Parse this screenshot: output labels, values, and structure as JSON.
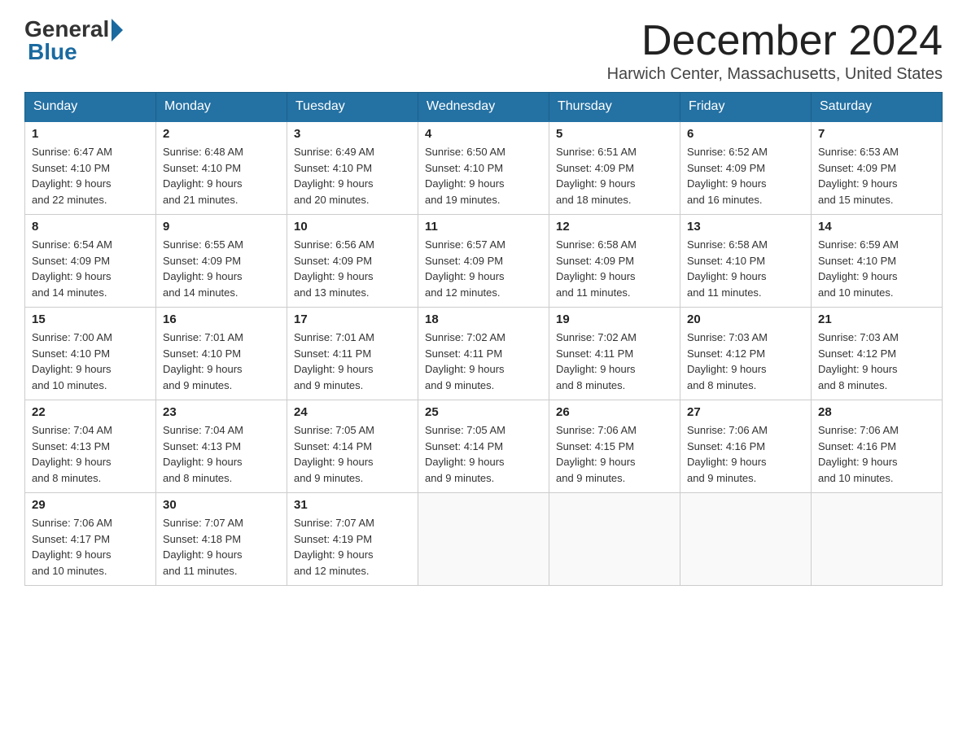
{
  "header": {
    "logo_general": "General",
    "logo_blue": "Blue",
    "month_title": "December 2024",
    "location": "Harwich Center, Massachusetts, United States"
  },
  "days_of_week": [
    "Sunday",
    "Monday",
    "Tuesday",
    "Wednesday",
    "Thursday",
    "Friday",
    "Saturday"
  ],
  "weeks": [
    [
      {
        "day": "1",
        "sunrise": "6:47 AM",
        "sunset": "4:10 PM",
        "daylight": "9 hours and 22 minutes."
      },
      {
        "day": "2",
        "sunrise": "6:48 AM",
        "sunset": "4:10 PM",
        "daylight": "9 hours and 21 minutes."
      },
      {
        "day": "3",
        "sunrise": "6:49 AM",
        "sunset": "4:10 PM",
        "daylight": "9 hours and 20 minutes."
      },
      {
        "day": "4",
        "sunrise": "6:50 AM",
        "sunset": "4:10 PM",
        "daylight": "9 hours and 19 minutes."
      },
      {
        "day": "5",
        "sunrise": "6:51 AM",
        "sunset": "4:09 PM",
        "daylight": "9 hours and 18 minutes."
      },
      {
        "day": "6",
        "sunrise": "6:52 AM",
        "sunset": "4:09 PM",
        "daylight": "9 hours and 16 minutes."
      },
      {
        "day": "7",
        "sunrise": "6:53 AM",
        "sunset": "4:09 PM",
        "daylight": "9 hours and 15 minutes."
      }
    ],
    [
      {
        "day": "8",
        "sunrise": "6:54 AM",
        "sunset": "4:09 PM",
        "daylight": "9 hours and 14 minutes."
      },
      {
        "day": "9",
        "sunrise": "6:55 AM",
        "sunset": "4:09 PM",
        "daylight": "9 hours and 14 minutes."
      },
      {
        "day": "10",
        "sunrise": "6:56 AM",
        "sunset": "4:09 PM",
        "daylight": "9 hours and 13 minutes."
      },
      {
        "day": "11",
        "sunrise": "6:57 AM",
        "sunset": "4:09 PM",
        "daylight": "9 hours and 12 minutes."
      },
      {
        "day": "12",
        "sunrise": "6:58 AM",
        "sunset": "4:09 PM",
        "daylight": "9 hours and 11 minutes."
      },
      {
        "day": "13",
        "sunrise": "6:58 AM",
        "sunset": "4:10 PM",
        "daylight": "9 hours and 11 minutes."
      },
      {
        "day": "14",
        "sunrise": "6:59 AM",
        "sunset": "4:10 PM",
        "daylight": "9 hours and 10 minutes."
      }
    ],
    [
      {
        "day": "15",
        "sunrise": "7:00 AM",
        "sunset": "4:10 PM",
        "daylight": "9 hours and 10 minutes."
      },
      {
        "day": "16",
        "sunrise": "7:01 AM",
        "sunset": "4:10 PM",
        "daylight": "9 hours and 9 minutes."
      },
      {
        "day": "17",
        "sunrise": "7:01 AM",
        "sunset": "4:11 PM",
        "daylight": "9 hours and 9 minutes."
      },
      {
        "day": "18",
        "sunrise": "7:02 AM",
        "sunset": "4:11 PM",
        "daylight": "9 hours and 9 minutes."
      },
      {
        "day": "19",
        "sunrise": "7:02 AM",
        "sunset": "4:11 PM",
        "daylight": "9 hours and 8 minutes."
      },
      {
        "day": "20",
        "sunrise": "7:03 AM",
        "sunset": "4:12 PM",
        "daylight": "9 hours and 8 minutes."
      },
      {
        "day": "21",
        "sunrise": "7:03 AM",
        "sunset": "4:12 PM",
        "daylight": "9 hours and 8 minutes."
      }
    ],
    [
      {
        "day": "22",
        "sunrise": "7:04 AM",
        "sunset": "4:13 PM",
        "daylight": "9 hours and 8 minutes."
      },
      {
        "day": "23",
        "sunrise": "7:04 AM",
        "sunset": "4:13 PM",
        "daylight": "9 hours and 8 minutes."
      },
      {
        "day": "24",
        "sunrise": "7:05 AM",
        "sunset": "4:14 PM",
        "daylight": "9 hours and 9 minutes."
      },
      {
        "day": "25",
        "sunrise": "7:05 AM",
        "sunset": "4:14 PM",
        "daylight": "9 hours and 9 minutes."
      },
      {
        "day": "26",
        "sunrise": "7:06 AM",
        "sunset": "4:15 PM",
        "daylight": "9 hours and 9 minutes."
      },
      {
        "day": "27",
        "sunrise": "7:06 AM",
        "sunset": "4:16 PM",
        "daylight": "9 hours and 9 minutes."
      },
      {
        "day": "28",
        "sunrise": "7:06 AM",
        "sunset": "4:16 PM",
        "daylight": "9 hours and 10 minutes."
      }
    ],
    [
      {
        "day": "29",
        "sunrise": "7:06 AM",
        "sunset": "4:17 PM",
        "daylight": "9 hours and 10 minutes."
      },
      {
        "day": "30",
        "sunrise": "7:07 AM",
        "sunset": "4:18 PM",
        "daylight": "9 hours and 11 minutes."
      },
      {
        "day": "31",
        "sunrise": "7:07 AM",
        "sunset": "4:19 PM",
        "daylight": "9 hours and 12 minutes."
      },
      null,
      null,
      null,
      null
    ]
  ],
  "labels": {
    "sunrise": "Sunrise:",
    "sunset": "Sunset:",
    "daylight": "Daylight:"
  }
}
